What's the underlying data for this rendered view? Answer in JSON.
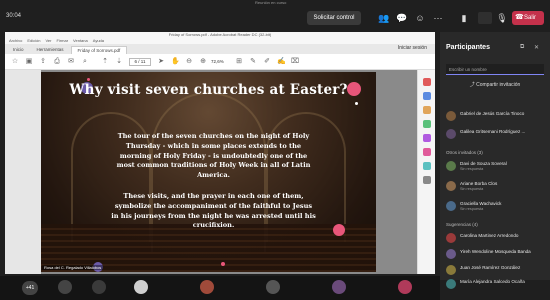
{
  "meeting": {
    "timer": "30:04",
    "caption": "Reunión en curso",
    "share_control_label": "Solicitar control",
    "leave_label": "Salir"
  },
  "acrobat": {
    "title": "Friday of Sorrows.pdf - Adobe Acrobat Reader DC (32-bit)",
    "menu": [
      "Archivo",
      "Edición",
      "Ver",
      "Firmar",
      "Ventana",
      "Ayuda"
    ],
    "tabs": [
      "Inicio",
      "Herramientas",
      "Friday of Sorrows.pdf"
    ],
    "sign_in": "Iniciar sesión",
    "page_indicator": "6 / 11",
    "zoom": "72,6%"
  },
  "slide": {
    "title": "Why visit seven churches at Easter?",
    "paragraph1": "The tour of the seven churches on the night of Holy Thursday - which in some places extends to the morning of Holy Friday - is undoubtedly one of the most common traditions of Holy Week in all of Latin America.",
    "paragraph2": "These visits, and the prayer in each one of them, symbolize the accompaniment of the faithful to Jesus in his journeys from the night he was arrested until his crucifixion.",
    "presenter_name": "Rosa del C. Regalado Villalobos"
  },
  "participants": {
    "title": "Participantes",
    "search_placeholder": "Escribir un nombre",
    "share_invite": "Compartir invitación",
    "top_people": [
      {
        "name": "Gabriel de Jesús García Tinoco",
        "color": "#7a5a3a"
      },
      {
        "name": "Galilea Gritsemani Rodríguez ...",
        "color": "#5b4a6a"
      }
    ],
    "others_label": "Otros invitados (3)",
    "others": [
      {
        "name": "Davi de Souza Soveral",
        "status": "Sin respuesta",
        "color": "#5a7a4a"
      },
      {
        "name": "Ariane Borba Clos",
        "status": "Sin respuesta",
        "color": "#8a6a4a"
      },
      {
        "name": "Graciella Wachavick",
        "status": "Sin respuesta",
        "color": "#4a6a8a"
      }
    ],
    "suggestions_label": "Sugerencias (4)",
    "suggestions": [
      {
        "name": "Carolina Martinez Arredondo",
        "color": "#9a3a3a"
      },
      {
        "name": "Yireh Wendoline Mosqueda Banda",
        "color": "#6a5a8a"
      },
      {
        "name": "Juan José Ramírez González",
        "color": "#8a7a3a"
      },
      {
        "name": "María Alejandra Salcedo Ocaña",
        "color": "#3a7a7a"
      }
    ]
  },
  "bottom_strip": {
    "more_count": "+41"
  }
}
